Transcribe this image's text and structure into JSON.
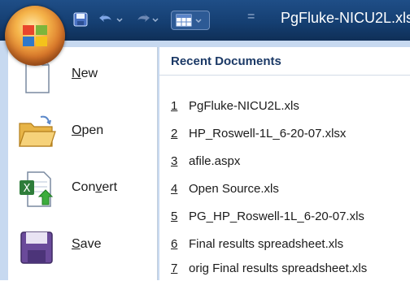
{
  "title_bar": {
    "title": "PgFluke-NICU2L.xls",
    "qat_separator": "="
  },
  "menu": {
    "items": [
      {
        "id": "new",
        "label": "New",
        "mnemonic": "N",
        "rest": "ew"
      },
      {
        "id": "open",
        "label": "Open",
        "mnemonic": "O",
        "rest": "pen"
      },
      {
        "id": "convert",
        "label": "Convert",
        "pre": "Con",
        "mnemonic": "v",
        "rest": "ert"
      },
      {
        "id": "save",
        "label": "Save",
        "mnemonic": "S",
        "rest": "ave"
      }
    ]
  },
  "recent": {
    "header": "Recent Documents",
    "items": [
      {
        "num": "1",
        "name": "PgFluke-NICU2L.xls"
      },
      {
        "num": "2",
        "name": "HP_Roswell-1L_6-20-07.xlsx"
      },
      {
        "num": "3",
        "name": "afile.aspx"
      },
      {
        "num": "4",
        "name": "Open Source.xls"
      },
      {
        "num": "5",
        "name": "PG_HP_Roswell-1L_6-20-07.xls"
      },
      {
        "num": "6",
        "name": "Final results spreadsheet.xls"
      },
      {
        "num": "7",
        "name": "orig Final results spreadsheet.xls"
      }
    ]
  },
  "colors": {
    "titlebar": "#153f72",
    "menu_frame": "#c7d9f0",
    "recent_header_text": "#1b3966"
  },
  "icons": {
    "office_button": "office-logo-icon",
    "qat_save": "save-icon",
    "qat_undo": "undo-icon",
    "qat_redo": "redo-icon",
    "qat_misc": "table-icon",
    "new": "blank-document-icon",
    "open": "folder-icon",
    "convert": "excel-convert-icon",
    "save": "floppy-disk-icon"
  }
}
